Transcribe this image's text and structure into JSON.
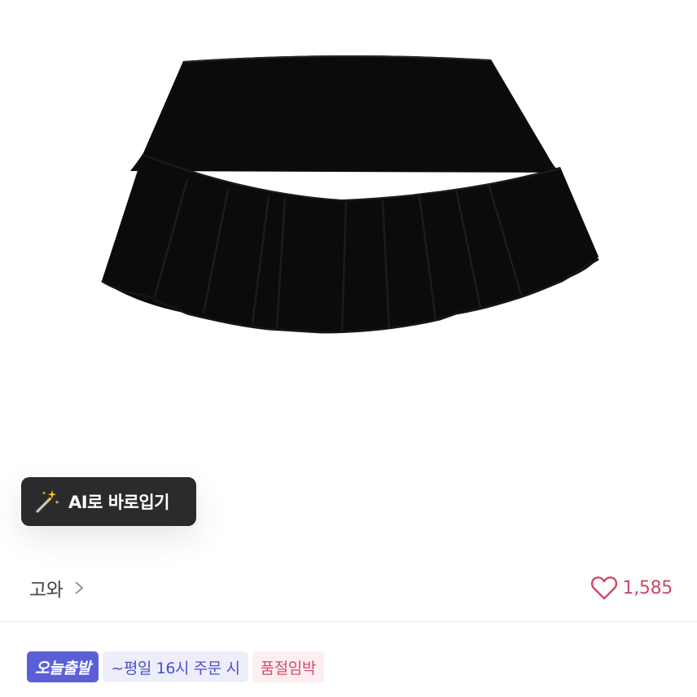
{
  "product": {
    "image_alt": "black pleated mini skirt"
  },
  "ai_tryon": {
    "icon": "magic-wand-sparkles-icon",
    "label": "AI로 바로입기"
  },
  "shop": {
    "name": "고와",
    "chevron_icon": "chevron-right-icon"
  },
  "likes": {
    "icon": "heart-outline-icon",
    "count": "1,585",
    "color": "#cc4a62"
  },
  "badges": [
    {
      "label": "오늘출발",
      "bg": "#5a5fd8",
      "fg": "#ffffff"
    },
    {
      "label": "~평일 16시 주문 시",
      "bg": "#eeeefb",
      "fg": "#4b50c8"
    },
    {
      "label": "품절임박",
      "bg": "#fdeff1",
      "fg": "#d0506a"
    }
  ]
}
